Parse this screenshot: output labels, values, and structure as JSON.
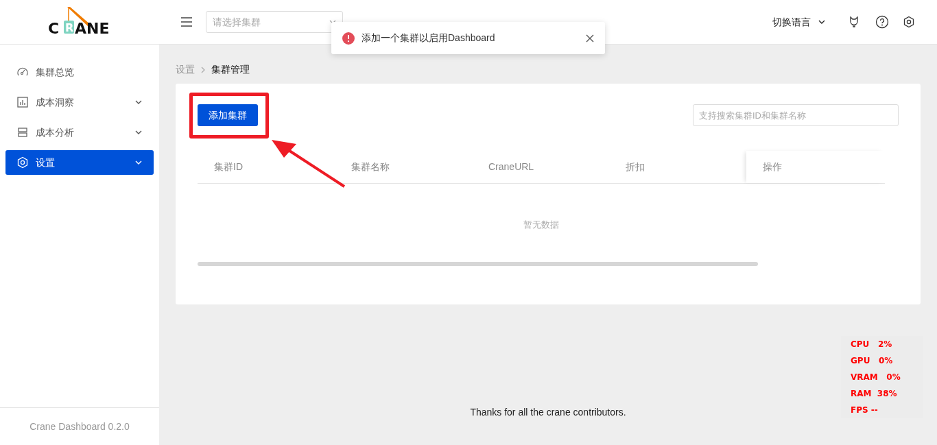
{
  "logo": {
    "letters": [
      "C",
      "R",
      "ANE"
    ]
  },
  "header": {
    "cluster_select": {
      "placeholder": "请选择集群"
    },
    "language_menu": "切换语言"
  },
  "toast": {
    "message": "添加一个集群以启用Dashboard"
  },
  "sidebar": {
    "items": [
      {
        "label": "集群总览",
        "kind": "gauge",
        "expandable": false,
        "selected": false
      },
      {
        "label": "成本洞察",
        "kind": "chart",
        "expandable": true,
        "selected": false
      },
      {
        "label": "成本分析",
        "kind": "layers",
        "expandable": true,
        "selected": false
      },
      {
        "label": "设置",
        "kind": "settings",
        "expandable": true,
        "selected": true
      }
    ],
    "version": "Crane Dashboard 0.2.0"
  },
  "breadcrumb": [
    {
      "label": "设置",
      "selected": false
    },
    {
      "label": "集群管理",
      "selected": true
    }
  ],
  "toolbar": {
    "add_button": "添加集群",
    "search": {
      "placeholder": "支持搜索集群ID和集群名称"
    }
  },
  "table": {
    "columns": [
      "集群ID",
      "集群名称",
      "CraneURL",
      "折扣",
      "操作"
    ],
    "empty_text": "暂无数据"
  },
  "footer": "Thanks for all the crane contributors.",
  "perf_overlay": [
    "CPU   2%",
    "GPU   0%",
    "VRAM   0%",
    "RAM  38%",
    "FPS --"
  ]
}
